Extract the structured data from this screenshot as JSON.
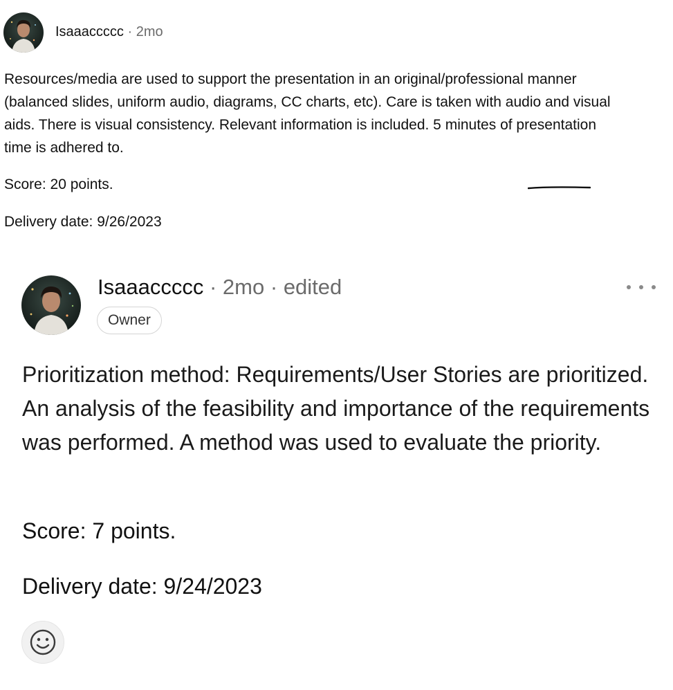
{
  "comments": [
    {
      "author": "Isaaaccccc",
      "separator": "·",
      "time": "2mo",
      "body": "Resources/media are used to support the presentation in an original/professional manner (balanced slides, uniform audio, diagrams, CC charts, etc). Care is taken with audio and visual aids. There is visual consistency. Relevant information is included. 5 minutes of presentation time is adhered to.",
      "score": "Score: 20 points.",
      "delivery_date": "Delivery date: 9/26/2023"
    },
    {
      "author": "Isaaaccccc",
      "separator": "·",
      "time": "2mo",
      "edited": "edited",
      "badge": "Owner",
      "body": "Prioritization method: Requirements/User Stories are prioritized. An analysis of the feasibility and importance of the requirements was performed. A method was used to evaluate the priority.",
      "score": "Score: 7 points.",
      "delivery_date": "Delivery date: 9/24/2023"
    }
  ],
  "icons": {
    "more": "more-options-icon",
    "react": "smiley-face-icon",
    "avatar": "user-avatar-photo"
  },
  "colors": {
    "text_primary": "#111111",
    "text_secondary": "#6b6b6b",
    "badge_border": "#d4d4d4",
    "react_bg": "#f1f1f1"
  }
}
